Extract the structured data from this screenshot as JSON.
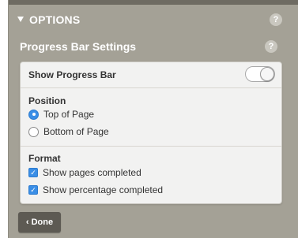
{
  "options": {
    "title": "OPTIONS",
    "help": "?"
  },
  "progress_bar_settings": {
    "title": "Progress Bar Settings",
    "help": "?",
    "show_progress_bar": {
      "label": "Show Progress Bar",
      "enabled": true
    },
    "position": {
      "label": "Position",
      "options": [
        {
          "label": "Top of Page",
          "selected": true
        },
        {
          "label": "Bottom of Page",
          "selected": false
        }
      ]
    },
    "format": {
      "label": "Format",
      "options": [
        {
          "label": "Show pages completed",
          "checked": true
        },
        {
          "label": "Show percentage completed",
          "checked": true
        }
      ]
    }
  },
  "done_button": {
    "chevron": "‹",
    "label": "Done"
  },
  "colors": {
    "panel_bg": "#a4a196",
    "accent": "#3a8ee6",
    "button_bg": "#5d5a53"
  },
  "icons": {
    "collapse": "triangle-down-icon",
    "help": "help-icon",
    "radio": "radio-icon",
    "checkbox": "checkbox-icon",
    "done_chevron": "chevron-left-icon"
  }
}
